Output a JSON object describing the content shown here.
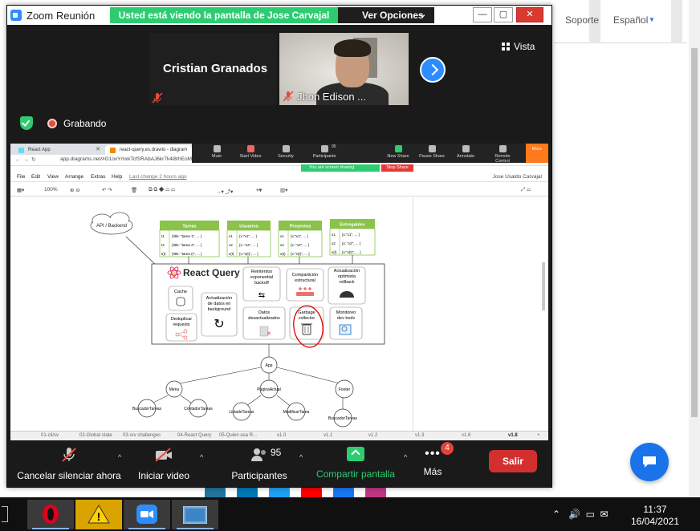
{
  "website": {
    "nav": [
      "Soporte",
      "Español"
    ]
  },
  "zoom": {
    "window_title": "Zoom Reunión",
    "share_banner": "Usted está viendo la pantalla de Jose Carvajal",
    "view_options": "Ver Opciones",
    "window_controls": [
      "—",
      "▢",
      "✕"
    ],
    "view_label": "Vista",
    "participant_name_tile": "Cristian Granados",
    "participant_video_tile": "Jhon Edison ...",
    "recording_label": "Grabando"
  },
  "shared_screen": {
    "browser_tabs": [
      "React App",
      "react-query.es.drawio - diagram"
    ],
    "url": "app.diagrams.net/#G1ovYmxkTcfSRAbAJ6kr7k4i8rhEoMm..",
    "presenter_controls": [
      {
        "label": "Mute"
      },
      {
        "label": "Start Video"
      },
      {
        "label": "Security"
      },
      {
        "label": "Participants",
        "count": "95"
      },
      {
        "label": "New Share"
      },
      {
        "label": "Pause Share"
      },
      {
        "label": "Annotate"
      },
      {
        "label": "Remote Control"
      },
      {
        "label": "More"
      }
    ],
    "sharing_status": "You are screen sharing",
    "stop_share": "Stop Share",
    "menu": [
      "File",
      "Edit",
      "View",
      "Arrange",
      "Extras",
      "Help"
    ],
    "last_change": "Last change 2 hours ago",
    "user": "Jose Usaldo Carvajal",
    "toolbar_zoom": "100%",
    "diagram": {
      "api_label": "API / Backend",
      "tables": [
        {
          "title": "Tareas",
          "rows": [
            [
              "t1",
              "{title: \"tarea 1\", ... }"
            ],
            [
              "t2",
              "{title: \"tarea 2\", ... }"
            ],
            [
              "t(t)",
              "{title: \"tarea (t\", ... }"
            ]
          ]
        },
        {
          "title": "Usuarios",
          "rows": [
            [
              "x1",
              "{x:\"x1\", ... }"
            ],
            [
              "x2",
              "{x: \"x2\", ... }"
            ],
            [
              "x(t)",
              "{x:\"x(t)\", ... }"
            ]
          ]
        },
        {
          "title": "Proyectos",
          "rows": [
            [
              "x1",
              "{x:\"x1\", ... }"
            ],
            [
              "x2",
              "{x: \"x2\", ... }"
            ],
            [
              "x(t)",
              "{x:\"x(t)\", ... }"
            ]
          ]
        },
        {
          "title": "Entregables",
          "rows": [
            [
              "x1",
              "{x:\"x1\", ... }"
            ],
            [
              "x2",
              "{x: \"x2\", ... }"
            ],
            [
              "x(t)",
              "{x:\"x(t)\", ... }"
            ]
          ]
        }
      ],
      "react_query_title": "React Query",
      "features": [
        "Cache",
        "Actualización de datos en background",
        "Reintentos exponential backoff",
        "Compartición estructural",
        "Actualización optimista rollback",
        "Deduplicar requests",
        "Datos desactualizados",
        "Garbage collector",
        "Monitoreo dev tools"
      ],
      "tree": {
        "root": "App",
        "children": [
          "Menu",
          "PaginaActual",
          "Footer"
        ],
        "menu_children": [
          "BuscadorTareas",
          "ContadorTareas"
        ],
        "pagina_children": [
          "ListadoTareas",
          "ModificarTarea"
        ],
        "footer_children": [
          "BuscadorTareas"
        ]
      }
    },
    "page_tabs": [
      "01-cli/sv",
      "02-Global state",
      "03-srv challenges",
      "04-React Query",
      "05-Quien usa R...",
      "v1.0",
      "v1.1",
      "v1.2",
      "v1.3",
      "v1.6",
      "v1.8"
    ]
  },
  "bottom_toolbar": {
    "mute_label": "Cancelar silenciar ahora",
    "video_label": "Iniciar video",
    "participants_label": "Participantes",
    "participants_count": "95",
    "share_label": "Compartir pantalla",
    "more_label": "Más",
    "more_badge": "4",
    "leave_label": "Salir"
  },
  "taskbar": {
    "time": "11:37",
    "date": "16/04/2021"
  },
  "colors": {
    "zoom_blue": "#2d8cff",
    "share_green": "#2ecc71",
    "leave_red": "#d32f2f",
    "table_header_green": "#8bc34a",
    "annotation_red": "#e00000"
  }
}
